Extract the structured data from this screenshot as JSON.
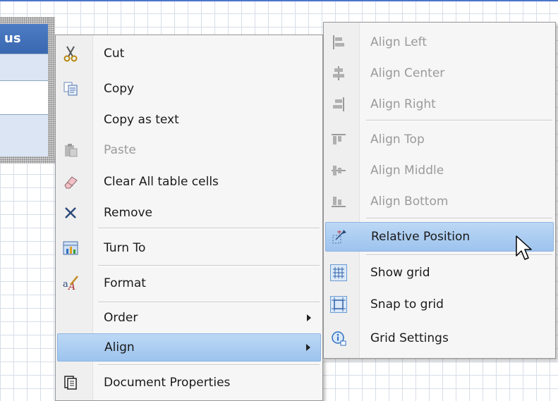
{
  "table": {
    "header_text": "us"
  },
  "menu": {
    "items": [
      {
        "label": "Cut",
        "icon": "scissors-icon",
        "disabled": false
      },
      {
        "label": "Copy",
        "icon": "copy-icon",
        "disabled": false
      },
      {
        "label": "Copy as text",
        "icon": "",
        "disabled": false
      },
      {
        "label": "Paste",
        "icon": "paste-icon",
        "disabled": true
      },
      {
        "label": "Clear All table cells",
        "icon": "eraser-icon",
        "disabled": false
      },
      {
        "label": "Remove",
        "icon": "remove-x-icon",
        "disabled": false
      },
      {
        "label": "Turn To",
        "icon": "chart-table-icon",
        "disabled": false
      },
      {
        "label": "Format",
        "icon": "format-icon",
        "disabled": false
      },
      {
        "label": "Order",
        "icon": "",
        "disabled": false,
        "submenu": true
      },
      {
        "label": "Align",
        "icon": "",
        "disabled": false,
        "submenu": true,
        "selected": true
      },
      {
        "label": "Document Properties",
        "icon": "document-properties-icon",
        "disabled": false
      }
    ]
  },
  "submenu": {
    "items": [
      {
        "label": "Align Left",
        "icon": "align-left-icon",
        "disabled": true
      },
      {
        "label": "Align Center",
        "icon": "align-center-icon",
        "disabled": true
      },
      {
        "label": "Align Right",
        "icon": "align-right-icon",
        "disabled": true
      },
      {
        "label": "Align Top",
        "icon": "align-top-icon",
        "disabled": true
      },
      {
        "label": "Align Middle",
        "icon": "align-middle-icon",
        "disabled": true
      },
      {
        "label": "Align Bottom",
        "icon": "align-bottom-icon",
        "disabled": true
      },
      {
        "label": "Relative Position",
        "icon": "relative-position-icon",
        "disabled": false,
        "selected": true
      },
      {
        "label": "Show grid",
        "icon": "grid-icon",
        "disabled": false,
        "checked": true
      },
      {
        "label": "Snap to grid",
        "icon": "snap-to-grid-icon",
        "disabled": false,
        "checked": true
      },
      {
        "label": "Grid Settings",
        "icon": "grid-settings-icon",
        "disabled": false
      }
    ]
  },
  "colors": {
    "selection": "#9dc3ee",
    "table_header": "#3f6fb8",
    "grid_line": "#d7dee8"
  }
}
